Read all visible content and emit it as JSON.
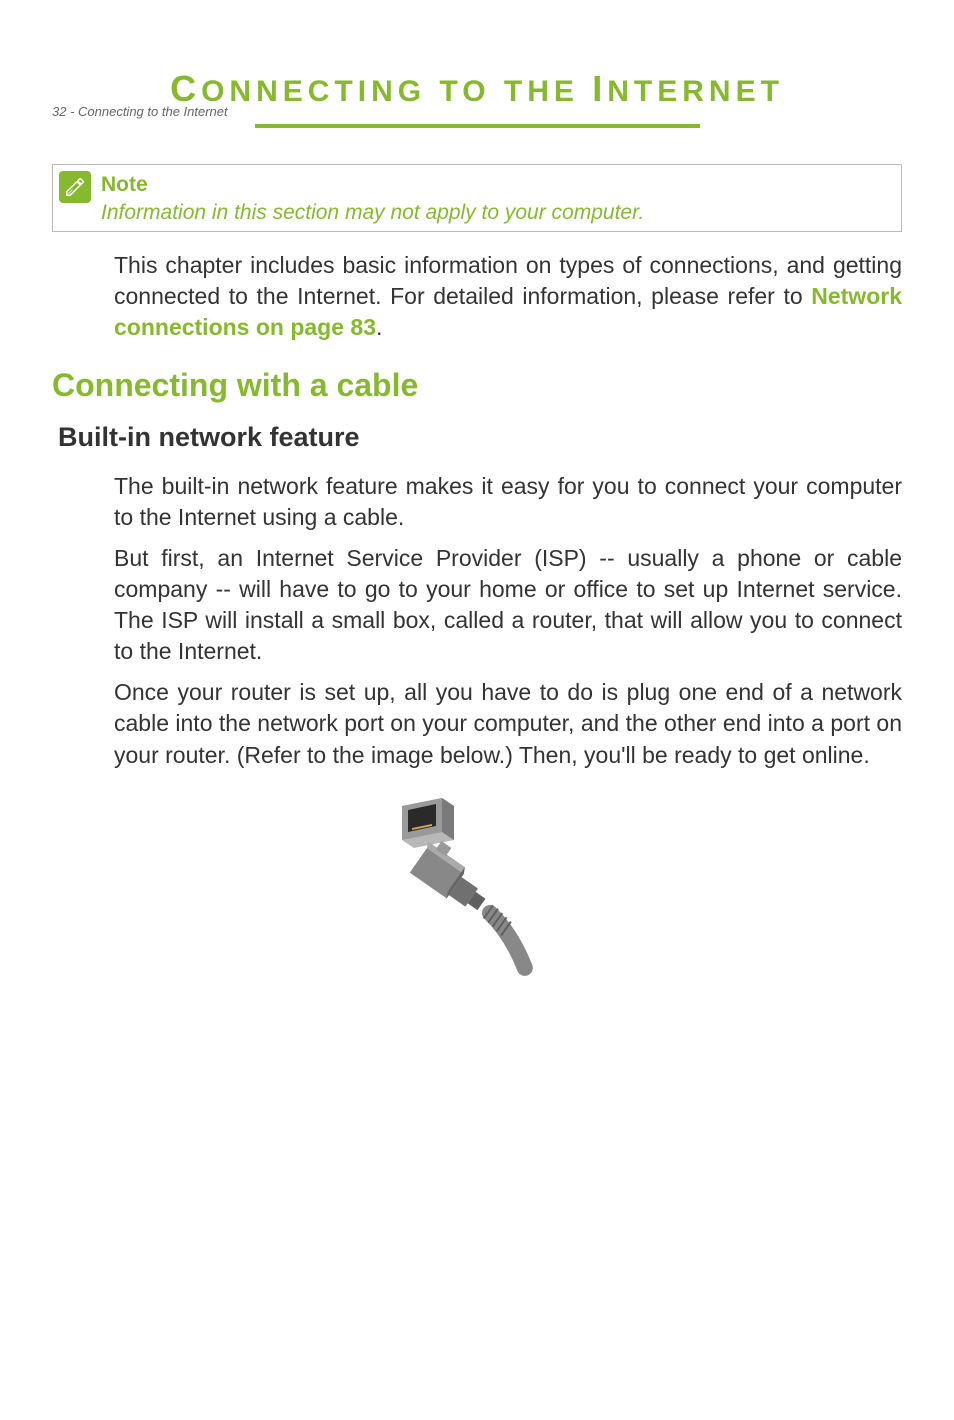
{
  "header": {
    "page_number": "32 - ",
    "section_name": "Connecting to the Internet"
  },
  "title": {
    "prefix_cap": "C",
    "prefix_rest": "ONNECTING TO THE ",
    "suffix_cap": "I",
    "suffix_rest": "NTERNET"
  },
  "note": {
    "heading": "Note",
    "text": "Information in this section may not apply to your computer."
  },
  "intro": {
    "text_before_link": "This chapter includes basic information on types of connections, and getting connected to the Internet. For detailed information, please refer to ",
    "link_text": "Network connections on page 83",
    "text_after_link": "."
  },
  "h2": "Connecting with a cable",
  "h3": "Built-in network feature",
  "paragraphs": {
    "p1": "The built-in network feature makes it easy for you to connect your computer to the Internet using a cable.",
    "p2": "But first, an Internet Service Provider (ISP) -- usually a phone or cable company -- will have to go to your home or office to set up Internet service. The ISP will install a small box, called a router, that will allow you to connect to the Internet.",
    "p3": "Once your router is set up, all you have to do is plug one end of a network cable into the network port on your computer, and the other end into a port on your router. (Refer to the image below.) Then, you'll be ready to get online."
  }
}
